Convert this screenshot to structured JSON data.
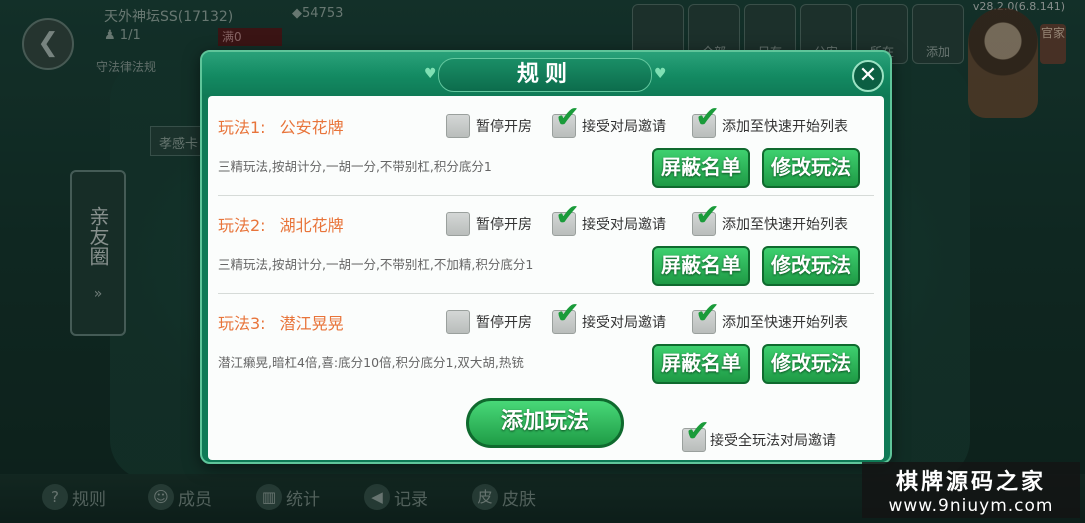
{
  "background": {
    "user_name": "天外神坛SS(17132)",
    "gems": "54753",
    "count": "1/1",
    "status": "满0",
    "notice": "守法律法规",
    "version": "v28.2.0(6.8.141)",
    "top_buttons": [
      "",
      "全部",
      "只有",
      "公安",
      "所在",
      "添加"
    ],
    "right_tag": "官家",
    "side_panel": "亲友圈",
    "side_arrow": "»",
    "slot_label": "孝感卡",
    "bottom_nav": [
      {
        "icon": "?",
        "label": "规则"
      },
      {
        "icon": "☺",
        "label": "成员"
      },
      {
        "icon": "▥",
        "label": "统计"
      },
      {
        "icon": "◀",
        "label": "记录"
      },
      {
        "icon": "皮",
        "label": "皮肤"
      }
    ],
    "watermark_line1": "棋牌源码之家",
    "watermark_line2": "www.9niuym.com"
  },
  "dialog": {
    "title": "规则",
    "close_icon": "✕",
    "pause_label": "暂停开房",
    "accept_label": "接受对局邀请",
    "quick_label": "添加至快速开始列表",
    "block_label": "屏蔽名单",
    "modify_label": "修改玩法",
    "add_label": "添加玩法",
    "accept_all_label": "接受全玩法对局邀请",
    "accept_all_checked": true,
    "rules": [
      {
        "index": "玩法1:",
        "name": "公安花牌",
        "desc": "三精玩法,按胡计分,一胡一分,不带别杠,积分底分1",
        "paused": false,
        "accept": true,
        "quick": true
      },
      {
        "index": "玩法2:",
        "name": "湖北花牌",
        "desc": "三精玩法,按胡计分,一胡一分,不带别杠,不加精,积分底分1",
        "paused": false,
        "accept": true,
        "quick": true
      },
      {
        "index": "玩法3:",
        "name": "潜江晃晃",
        "desc": "潜江癞晃,暗杠4倍,喜:底分10倍,积分底分1,双大胡,热铳",
        "paused": false,
        "accept": true,
        "quick": true
      }
    ]
  },
  "colors": {
    "dialog_green": "#0f7a56",
    "button_green": "#1e9a45",
    "rule_title_orange": "#e8743a",
    "check_green": "#1a9b3a"
  }
}
